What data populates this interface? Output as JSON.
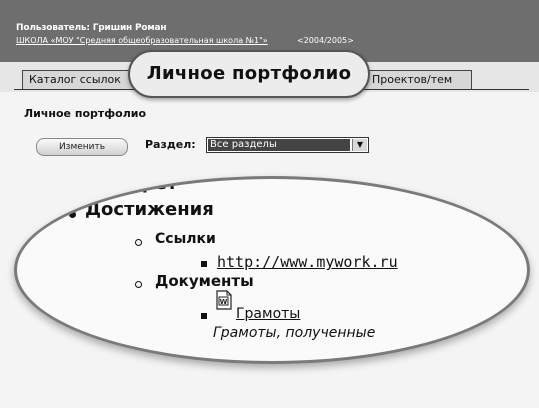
{
  "header": {
    "user_line": "Пользователь: Гришин Роман",
    "school_line": "ШКОЛА «МОУ \"Средняя общеобразовательная школа №1\"»",
    "school_year": "<2004/2005>"
  },
  "tabs": {
    "catalog": "Каталог ссылок",
    "portfolio": "Личное портфолио",
    "projects": "Проектов/тем"
  },
  "page_title": "Личное портфолио",
  "controls": {
    "edit_button": "Изменить",
    "section_label": "Раздел:",
    "section_value": "Все разделы"
  },
  "tree": {
    "portrait": "Портрет",
    "achievements": "Достижения",
    "links_header": "Ссылки",
    "link_url": "http://www.mywork.ru",
    "documents_header": "Документы",
    "doc_title": "Грамоты",
    "doc_desc": "Грамоты, полученные",
    "doc_icon": "word-document-icon"
  },
  "colors": {
    "header_bg": "#6e6e6e",
    "select_highlight": "#444444"
  }
}
